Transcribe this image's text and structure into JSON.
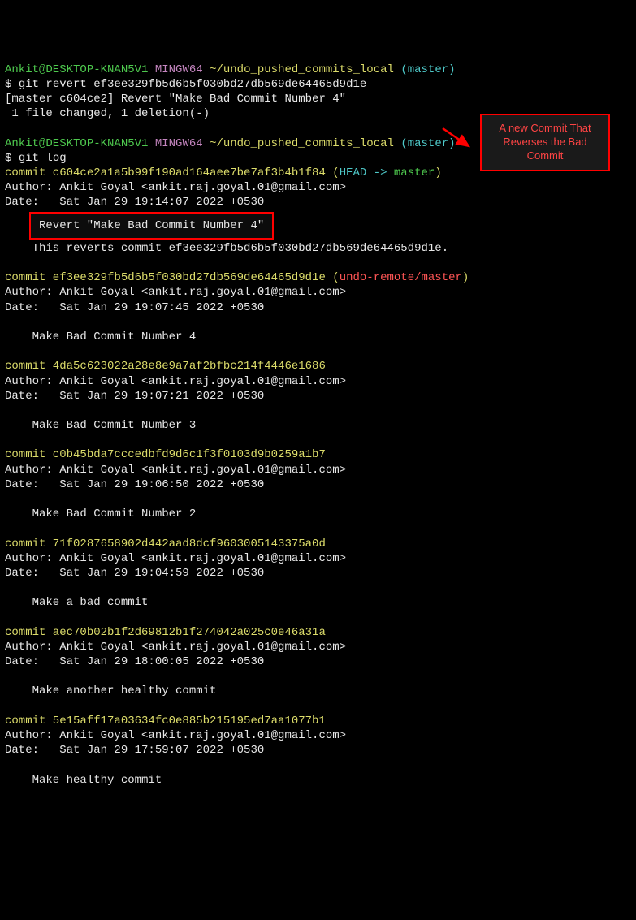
{
  "p1": {
    "user": "Ankit@DESKTOP-KNAN5V1",
    "shell": "MINGW64",
    "path": "~/undo_pushed_commits_local",
    "branch": "(master)",
    "cmd": "git revert ef3ee329fb5d6b5f030bd27db569de64465d9d1e",
    "out1": "[master c604ce2] Revert \"Make Bad Commit Number 4\"",
    "out2": " 1 file changed, 1 deletion(-)"
  },
  "p2": {
    "user": "Ankit@DESKTOP-KNAN5V1",
    "shell": "MINGW64",
    "path": "~/undo_pushed_commits_local",
    "branch": "(master)",
    "cmd": "git log"
  },
  "c0": {
    "line": "commit c604ce2a1a5b99f190ad164aee7be7af3b4b1f84",
    "head": "HEAD -> ",
    "branch": "master",
    "author": "Author: Ankit Goyal <ankit.raj.goyal.01@gmail.com>",
    "date": "Date:   Sat Jan 29 19:14:07 2022 +0530",
    "msg": "Revert \"Make Bad Commit Number 4\"",
    "note": "    This reverts commit ef3ee329fb5d6b5f030bd27db569de64465d9d1e."
  },
  "c1": {
    "line": "commit ef3ee329fb5d6b5f030bd27db569de64465d9d1e",
    "remote": "undo-remote/master",
    "author": "Author: Ankit Goyal <ankit.raj.goyal.01@gmail.com>",
    "date": "Date:   Sat Jan 29 19:07:45 2022 +0530",
    "msg": "    Make Bad Commit Number 4"
  },
  "c2": {
    "line": "commit 4da5c623022a28e8e9a7af2bfbc214f4446e1686",
    "author": "Author: Ankit Goyal <ankit.raj.goyal.01@gmail.com>",
    "date": "Date:   Sat Jan 29 19:07:21 2022 +0530",
    "msg": "    Make Bad Commit Number 3"
  },
  "c3": {
    "line": "commit c0b45bda7cccedbfd9d6c1f3f0103d9b0259a1b7",
    "author": "Author: Ankit Goyal <ankit.raj.goyal.01@gmail.com>",
    "date": "Date:   Sat Jan 29 19:06:50 2022 +0530",
    "msg": "    Make Bad Commit Number 2"
  },
  "c4": {
    "line": "commit 71f0287658902d442aad8dcf9603005143375a0d",
    "author": "Author: Ankit Goyal <ankit.raj.goyal.01@gmail.com>",
    "date": "Date:   Sat Jan 29 19:04:59 2022 +0530",
    "msg": "    Make a bad commit"
  },
  "c5": {
    "line": "commit aec70b02b1f2d69812b1f274042a025c0e46a31a",
    "author": "Author: Ankit Goyal <ankit.raj.goyal.01@gmail.com>",
    "date": "Date:   Sat Jan 29 18:00:05 2022 +0530",
    "msg": "    Make another healthy commit"
  },
  "c6": {
    "line": "commit 5e15aff17a03634fc0e885b215195ed7aa1077b1",
    "author": "Author: Ankit Goyal <ankit.raj.goyal.01@gmail.com>",
    "date": "Date:   Sat Jan 29 17:59:07 2022 +0530",
    "msg": "    Make healthy commit"
  },
  "annotation": "A new Commit That Reverses the Bad Commit"
}
